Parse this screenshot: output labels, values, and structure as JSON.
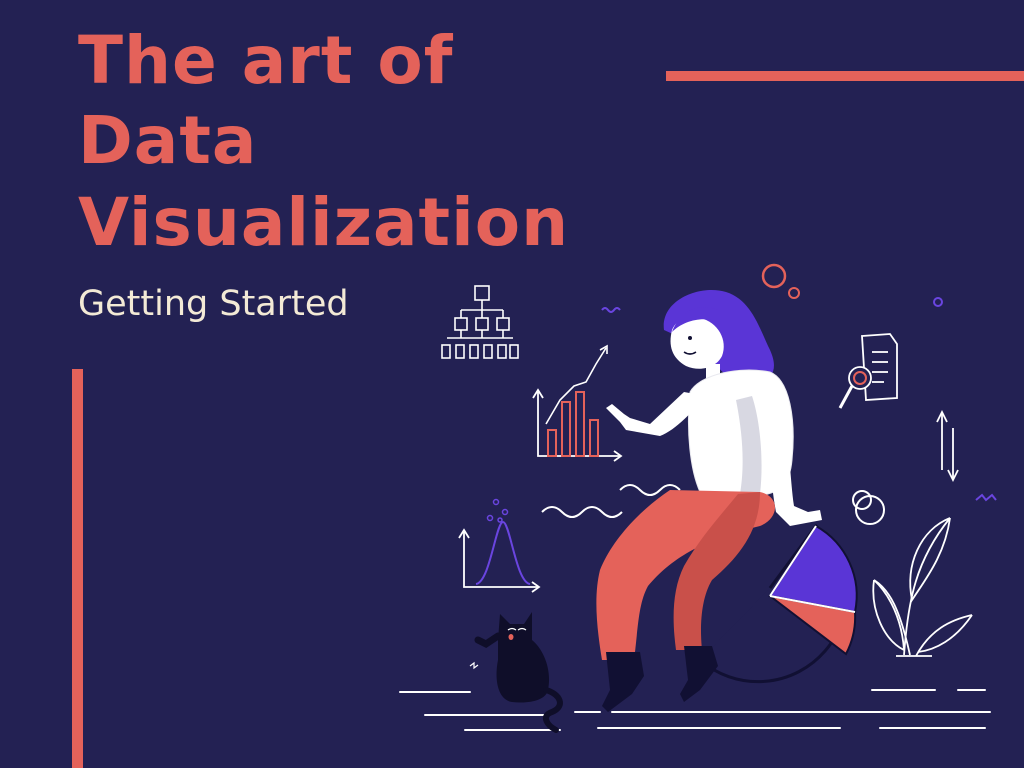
{
  "title": {
    "line1": "The art of",
    "line2": "Data",
    "line3": "Visualization"
  },
  "subtitle": "Getting Started",
  "colors": {
    "background": "#232153",
    "accent": "#e4625a",
    "text_light": "#f3ead6",
    "purple": "#5a35d6",
    "outline": "#ffffff"
  },
  "illustration": {
    "icons": [
      "org-chart-icon",
      "bar-chart-icon",
      "bell-curve-icon",
      "document-magnifier-icon",
      "up-down-arrows-icon",
      "pie-chart-icon",
      "plant-icon",
      "cat-icon",
      "person-icon"
    ]
  }
}
